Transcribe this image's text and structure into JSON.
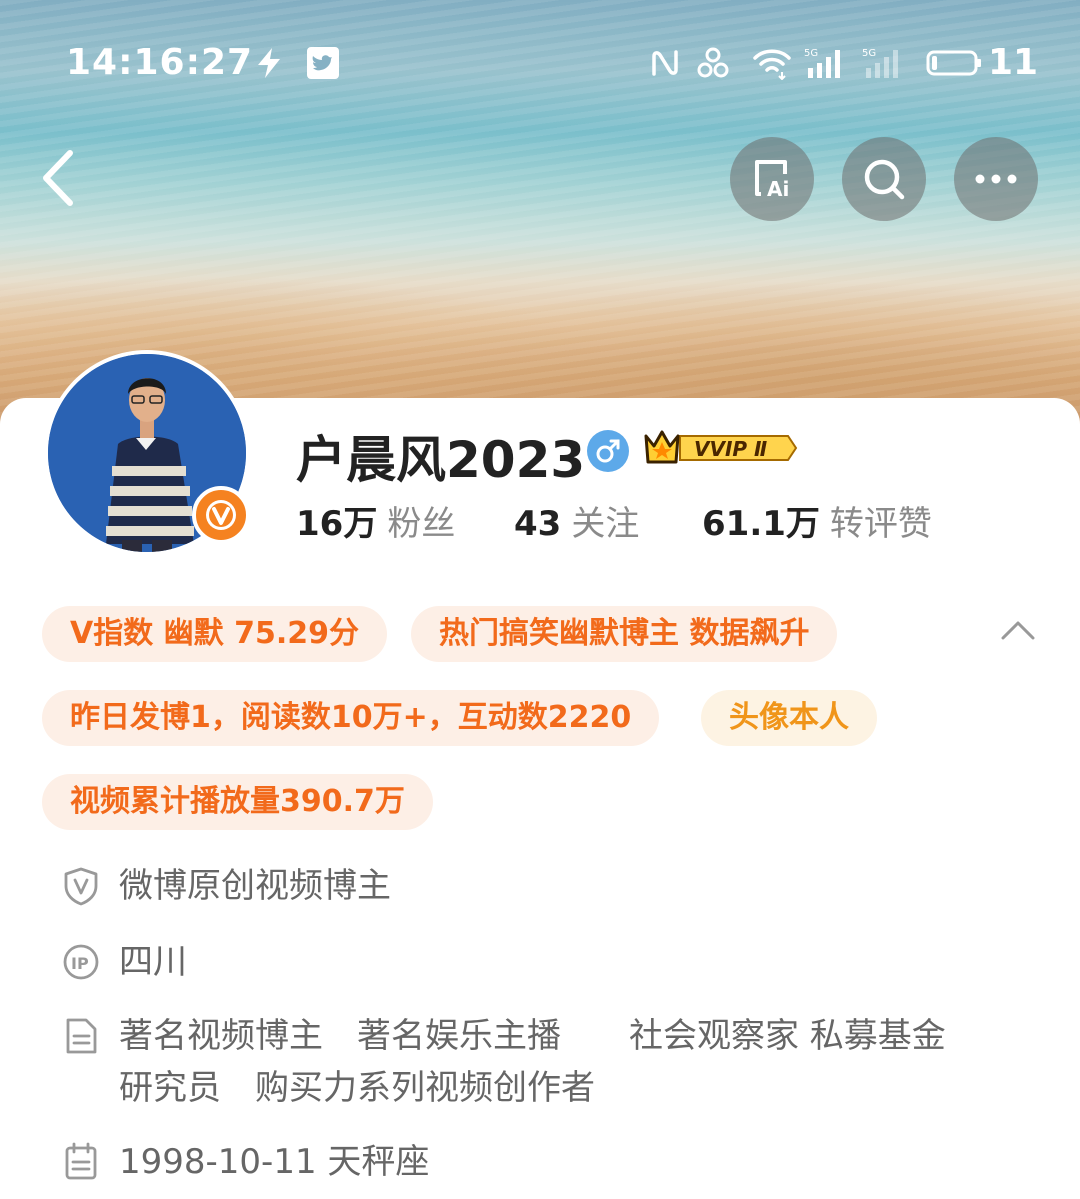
{
  "status_bar": {
    "time": "14:16:27",
    "battery": "11",
    "icons": [
      "flash-icon",
      "twitter-icon",
      "nfc-icon",
      "hotspot-icon",
      "wifi-icon",
      "signal-5g-icon",
      "signal-5g-icon",
      "battery-icon"
    ]
  },
  "header": {
    "back_icon": "chevron-left-icon",
    "actions": [
      "ai-icon",
      "search-icon",
      "more-icon"
    ]
  },
  "profile": {
    "name": "户晨风2023",
    "gender_icon": "male-icon",
    "vip_badge": "VVIP Ⅱ",
    "stats": [
      {
        "num": "16万",
        "label": "粉丝"
      },
      {
        "num": "43",
        "label": "关注"
      },
      {
        "num": "61.1万",
        "label": "转评赞"
      }
    ]
  },
  "tags": [
    "V指数 幽默 75.29分",
    "热门搞笑幽默博主 数据飙升",
    "昨日发博1，阅读数10万+，互动数2220",
    "头像本人",
    "视频累计播放量390.7万"
  ],
  "info": {
    "verification": "微博原创视频博主",
    "ip": "四川",
    "bio_line1": "著名视频博主　著名娱乐主播　　社会观察家 私募基金",
    "bio_line2": "研究员　购买力系列视频创作者",
    "birthday": "1998-10-11 天秤座"
  },
  "colors": {
    "accent_orange": "#f26a1b",
    "tag_bg": "#fdefe6",
    "gold": "#f0951a",
    "verified_orange": "#f58220",
    "male_blue": "#5da9e9"
  }
}
